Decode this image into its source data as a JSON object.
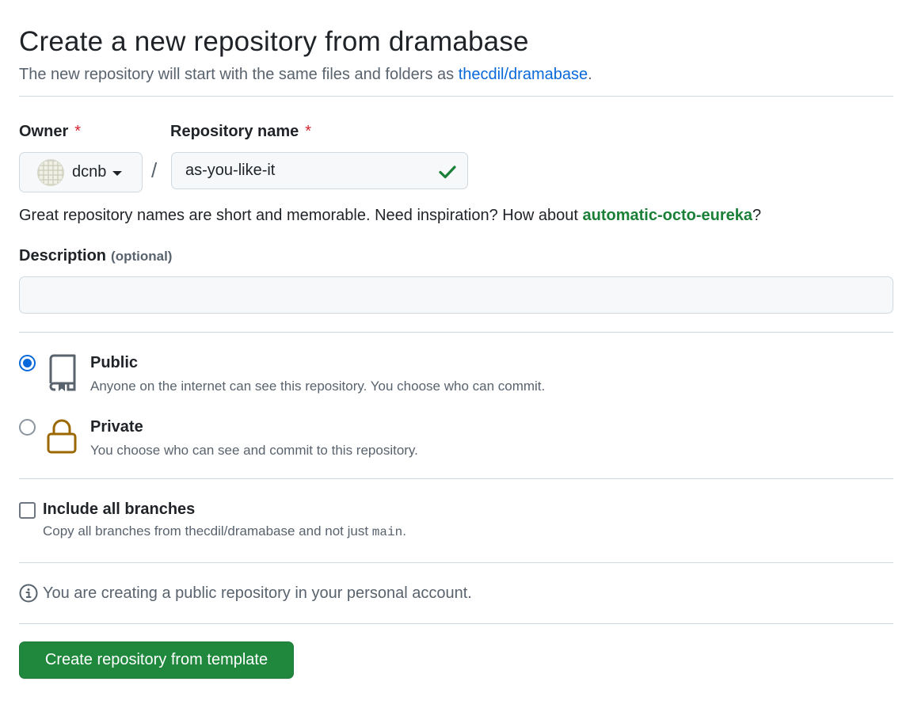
{
  "header": {
    "title": "Create a new repository from dramabase",
    "subtitle_prefix": "The new repository will start with the same files and folders as",
    "template_link": "thecdil/dramabase",
    "subtitle_suffix": "."
  },
  "owner": {
    "label": "Owner",
    "required_mark": "*",
    "value": "dcnb"
  },
  "separator": "/",
  "repo_name": {
    "label": "Repository name",
    "required_mark": "*",
    "value": "as-you-like-it"
  },
  "hint": {
    "prefix": "Great repository names are short and memorable. Need inspiration? How about",
    "suggestion": "automatic-octo-eureka",
    "suffix": "?"
  },
  "description": {
    "label": "Description",
    "optional": "(optional)",
    "value": "",
    "placeholder": ""
  },
  "visibility": {
    "selected": "public",
    "options": [
      {
        "id": "public",
        "label": "Public",
        "description": "Anyone on the internet can see this repository. You choose who can commit."
      },
      {
        "id": "private",
        "label": "Private",
        "description": "You choose who can see and commit to this repository."
      }
    ]
  },
  "include_branches": {
    "label": "Include all branches",
    "checked": false,
    "description_prefix": "Copy all branches from thecdil/dramabase and not just",
    "branch": "main",
    "description_suffix": "."
  },
  "info": {
    "text": "You are creating a public repository in your personal account."
  },
  "submit": {
    "label": "Create repository from template"
  },
  "colors": {
    "accent": "#0969da",
    "success": "#1f883d",
    "suggestion": "#1a7f37",
    "required": "#d1242f",
    "lock": "#9a6700"
  },
  "icons": {
    "check": "check-icon",
    "public": "repo-icon",
    "private": "lock-icon",
    "info": "info-icon",
    "caret": "triangle-down-icon"
  }
}
